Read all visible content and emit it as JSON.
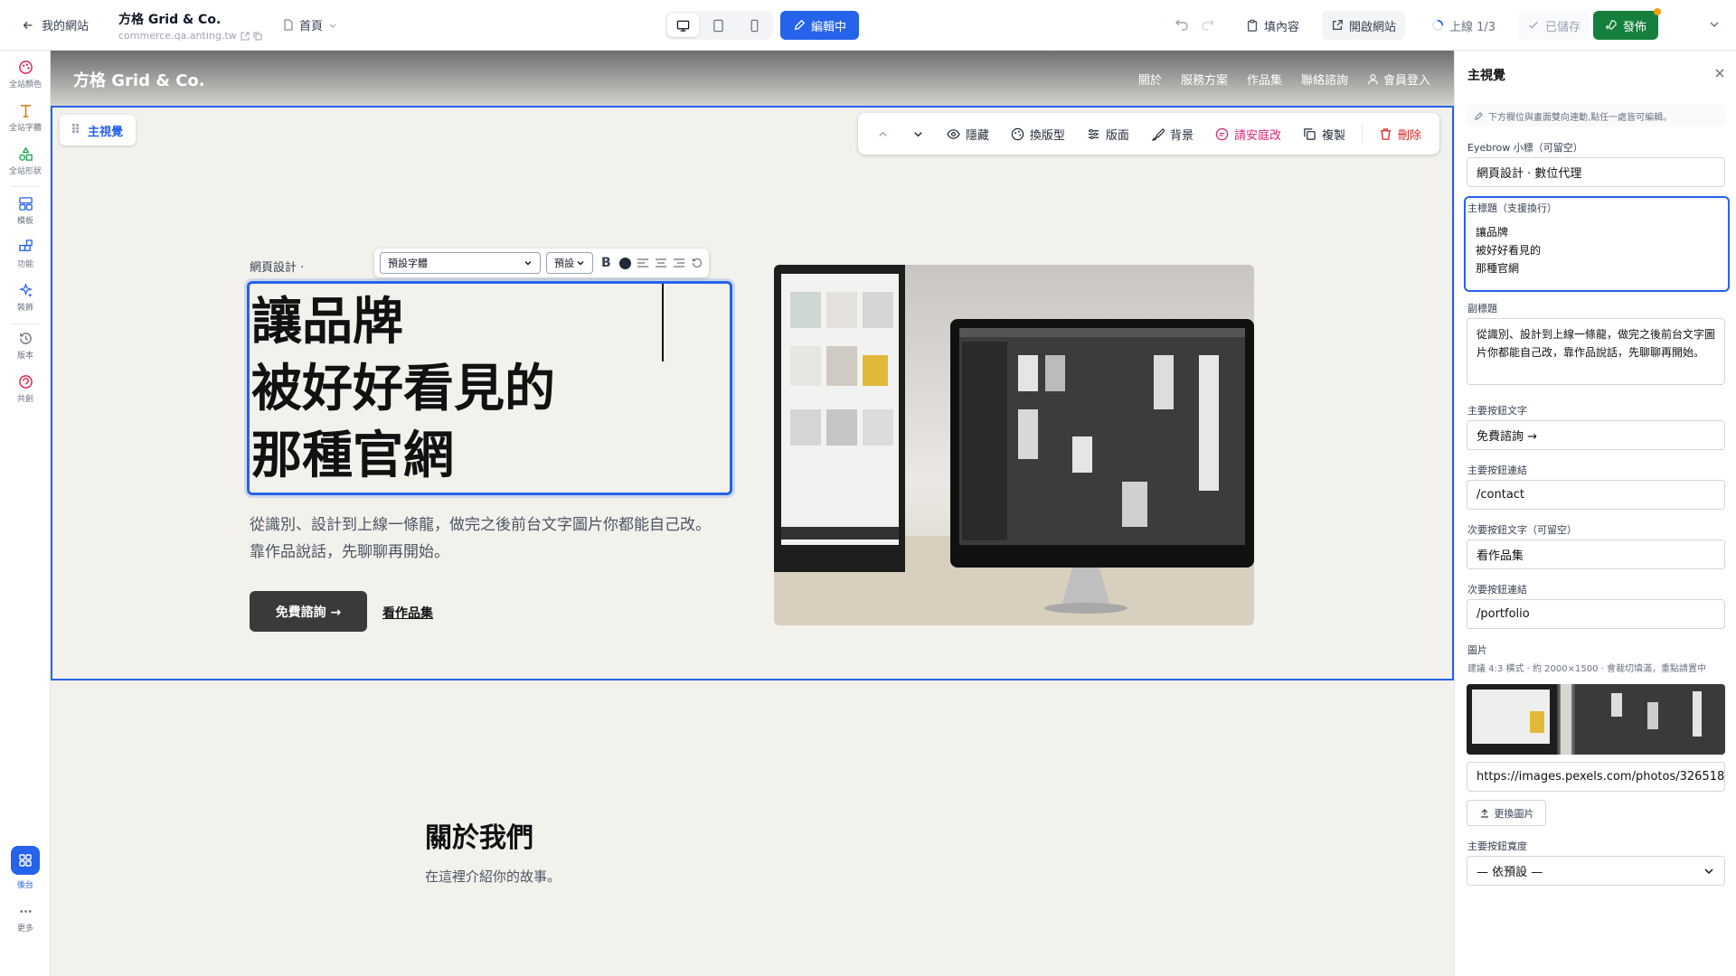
{
  "topbar": {
    "back_label": "我的網站",
    "site_name": "方格 Grid & Co.",
    "site_domain": "commerce.qa.anting.tw",
    "page_label": "首頁",
    "edit_label": "編輯中",
    "fill_label": "填內容",
    "open_site_label": "開啟網站",
    "status_label": "上線 1/3",
    "saved_label": "已儲存",
    "publish_label": "發佈"
  },
  "leftrail": {
    "items": [
      "全站顏色",
      "全站字體",
      "全站形狀",
      "模板",
      "功能",
      "裝飾",
      "版本",
      "共創"
    ],
    "dashboard_label": "後台",
    "more_label": "更多"
  },
  "site": {
    "logo": "方格 Grid & Co.",
    "nav": [
      "關於",
      "服務方案",
      "作品集",
      "聯絡諮詢"
    ],
    "login_label": "會員登入"
  },
  "hero": {
    "chip_label": "主視覺",
    "toolbar": {
      "hide": "隱藏",
      "change_type": "換版型",
      "layout": "版面",
      "background": "背景",
      "ask_ting": "請安庭改",
      "duplicate": "複製",
      "delete": "刪除"
    },
    "eyebrow": "網頁設計 ·",
    "text_toolbar": {
      "font": "預設字體",
      "size": "預設",
      "bold": "B"
    },
    "headline": [
      "讓品牌",
      "被好好看見的",
      "那種官網"
    ],
    "subtitle": "從識別、設計到上線一條龍，做完之後前台文字圖片你都能自己改。靠作品說話，先聊聊再開始。",
    "cta_primary": "免費諮詢 →",
    "cta_secondary": "看作品集"
  },
  "about": {
    "title": "關於我們",
    "text": "在這裡介紹你的故事。"
  },
  "panel": {
    "title": "主視覺",
    "hint": "下方欄位與畫面雙向連動,點任一處皆可編輯。",
    "eyebrow_label": "Eyebrow 小標（可留空）",
    "eyebrow_value": "網頁設計 · 數位代理",
    "headline_label": "主標題（支援換行）",
    "headline_lines": [
      "讓品牌",
      "被好好看見的",
      "那種官網"
    ],
    "subtitle_label": "副標題",
    "subtitle_value": "從識別、設計到上線一條龍，做完之後前台文字圖片你都能自己改，靠作品說話，先聊聊再開始。",
    "primary_text_label": "主要按鈕文字",
    "primary_text_value": "免費諮詢 →",
    "primary_link_label": "主要按鈕連結",
    "primary_link_value": "/contact",
    "secondary_text_label": "次要按鈕文字（可留空）",
    "secondary_text_value": "看作品集",
    "secondary_link_label": "次要按鈕連結",
    "secondary_link_value": "/portfolio",
    "image_label": "圖片",
    "image_note": "建議 4:3 橫式 · 約 2000×1500 · 會裁切填滿，重點請置中",
    "image_url": "https://images.pexels.com/photos/326518",
    "replace_label": "更換圖片",
    "width_label": "主要按鈕寬度",
    "width_value": "— 依預設 —"
  }
}
